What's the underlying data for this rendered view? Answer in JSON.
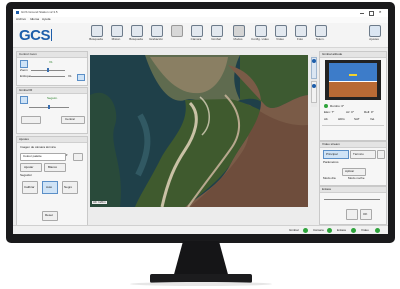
{
  "window": {
    "title": "GCS Ground Station v2.3.5"
  },
  "menu": [
    "Archivo",
    "Idioma",
    "Ayuda"
  ],
  "logo": {
    "text": "GCS"
  },
  "toolbar": [
    {
      "label": "Búsqueda",
      "icon": "search-icon"
    },
    {
      "label": "Mision",
      "icon": "mission-icon"
    },
    {
      "label": "Búsqueda",
      "icon": "target-icon"
    },
    {
      "label": "Grabación",
      "icon": "record-icon"
    },
    {
      "label": "",
      "icon": "blank-icon"
    },
    {
      "label": "Cámara",
      "icon": "camera-icon"
    },
    {
      "label": "Gimbal",
      "icon": "gimbal-icon"
    },
    {
      "label": "Modos",
      "icon": "mode-icon"
    },
    {
      "label": "Config. vídeo",
      "icon": "video-config-icon"
    },
    {
      "label": "Vídeo",
      "icon": "video-icon"
    },
    {
      "label": "Foto",
      "icon": "photo-icon"
    },
    {
      "label": "Telem.",
      "icon": "telemetry-icon"
    }
  ],
  "toolbar_right": {
    "label": "Ajustes",
    "icon": "settings-icon"
  },
  "left_panel": {
    "control_title": "Control zoom",
    "zoom_label": "Zoom",
    "zoom_value": "X1",
    "focus_label": "Enfoque",
    "focus_value": "X1",
    "gimbal_title": "Gimbal IR",
    "gimbal_mode": "Seguim.",
    "gimbal_btn": "Centrar",
    "ir_title": "Ajustes",
    "ir_subtitle": "Imagen de cámara térmica",
    "palette_select": "Colour palette",
    "auto_label": "Ajustar",
    "white_label": "Blanco",
    "black_label": "Negro",
    "tracker_label": "Seguidor",
    "calib_btn": "Calibrar",
    "tracker_btn": "Auto",
    "reset_btn": "Reset"
  },
  "right_panel": {
    "attitude_title": "Gimbal attitude",
    "tabs": [
      "Atti",
      "Datos"
    ],
    "heading": "Rumbo: 0°",
    "values": [
      "Elev: 7°",
      "Az: 0°",
      "Roll: 0°"
    ],
    "stats_row": [
      "Alt.",
      "HDG",
      "SAT",
      "Vel."
    ],
    "video_title": "Vídeo stream",
    "video_btns": [
      "Principal",
      "Térmico"
    ],
    "settings_title": "Parámetros",
    "apply_btn": "Aplicar",
    "tab_row": [
      "Modo día",
      "Modo noche"
    ],
    "extra_title": "Enlace",
    "ok_btn": "OK"
  },
  "map": {
    "caption": "Alt: 120m"
  },
  "status": [
    {
      "label": "Gimbal",
      "state": "ok"
    },
    {
      "label": "Cámara",
      "state": "ok"
    },
    {
      "label": "Enlace",
      "state": "ok"
    },
    {
      "label": "Vídeo",
      "state": "ok"
    }
  ],
  "colors": {
    "accent": "#1e5eaa",
    "ok": "#2fa43c",
    "monitor": "#1a1a1c"
  }
}
